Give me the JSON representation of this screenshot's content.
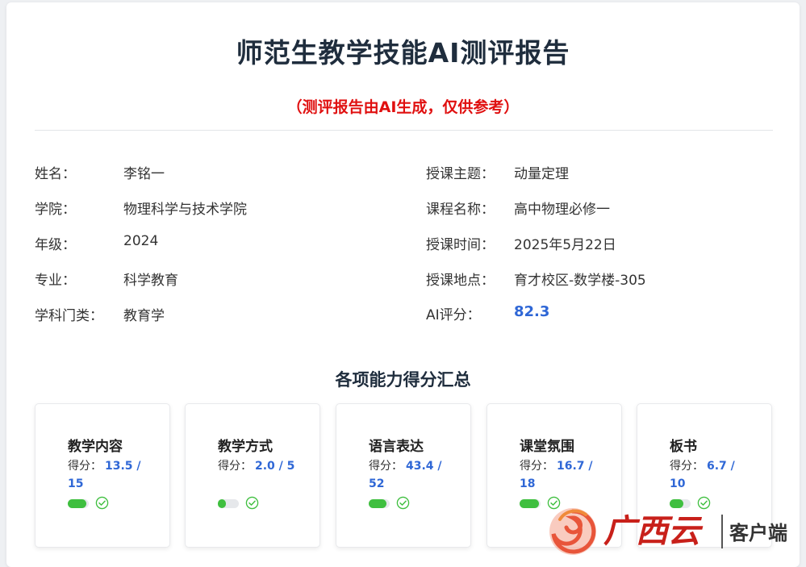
{
  "report": {
    "title": "师范生教学技能AI测评报告",
    "disclaimer": "（测评报告由AI生成，仅供参考）"
  },
  "info_left": [
    {
      "label": "姓名：",
      "value": "李铭一"
    },
    {
      "label": "学院：",
      "value": "物理科学与技术学院"
    },
    {
      "label": "年级：",
      "value": "2024"
    },
    {
      "label": "专业：",
      "value": "科学教育"
    },
    {
      "label": "学科门类：",
      "value": "教育学"
    }
  ],
  "info_right": [
    {
      "label": "授课主题：",
      "value": "动量定理"
    },
    {
      "label": "课程名称：",
      "value": "高中物理必修一"
    },
    {
      "label": "授课时间：",
      "value": "2025年5月22日"
    },
    {
      "label": "授课地点：",
      "value": "育才校区-数学楼-305"
    },
    {
      "label": "AI评分：",
      "value": "82.3"
    }
  ],
  "summary": {
    "title": "各项能力得分汇总",
    "cards": [
      {
        "name": "教学内容",
        "score_label": "得分：",
        "score_text": "13.5 / 15",
        "fraction": 0.9
      },
      {
        "name": "教学方式",
        "score_label": "得分：",
        "score_text": "2.0 / 5",
        "fraction": 0.4
      },
      {
        "name": "语言表达",
        "score_label": "得分：",
        "score_text": "43.4 / 52",
        "fraction": 0.83
      },
      {
        "name": "课堂氛围",
        "score_label": "得分：",
        "score_text": "16.7 / 18",
        "fraction": 0.93
      },
      {
        "name": "板书",
        "score_label": "得分：",
        "score_text": "6.7 / 10",
        "fraction": 0.67
      }
    ]
  },
  "colors": {
    "accent_blue": "#2f67d6",
    "disclaimer_red": "#e01010",
    "bar_green": "#3fbf3f"
  },
  "watermark": {
    "brand": "广西云",
    "suffix": "客户端"
  }
}
